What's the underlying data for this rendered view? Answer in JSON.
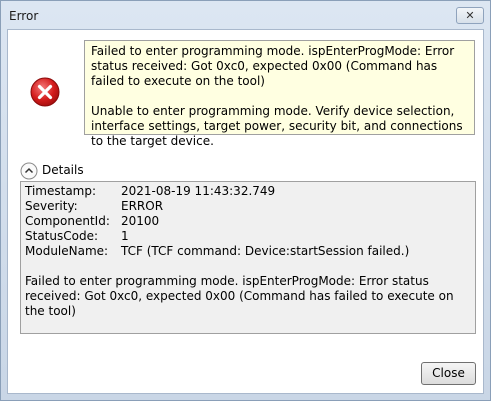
{
  "window": {
    "title": "Error",
    "close_glyph": "✕"
  },
  "icon": {
    "name": "error-icon",
    "color": "#d41c1c"
  },
  "message": {
    "paragraph1": "Failed to enter programming mode. ispEnterProgMode: Error status received: Got 0xc0, expected 0x00 (Command has failed to execute on the tool)",
    "paragraph2": "Unable to enter programming mode. Verify device selection, interface settings, target power, security bit, and connections to the target device."
  },
  "details": {
    "label": "Details",
    "fields": [
      {
        "key": "Timestamp:",
        "value": "2021-08-19 11:43:32.749"
      },
      {
        "key": "Severity:",
        "value": "ERROR"
      },
      {
        "key": "ComponentId:",
        "value": "20100"
      },
      {
        "key": "StatusCode:",
        "value": "1"
      },
      {
        "key": "ModuleName:",
        "value": "TCF (TCF command: Device:startSession failed.)"
      }
    ],
    "message": "Failed to enter programming mode. ispEnterProgMode: Error status received: Got 0xc0, expected 0x00 (Command has failed to execute on the tool)"
  },
  "buttons": {
    "close_label": "Close"
  }
}
